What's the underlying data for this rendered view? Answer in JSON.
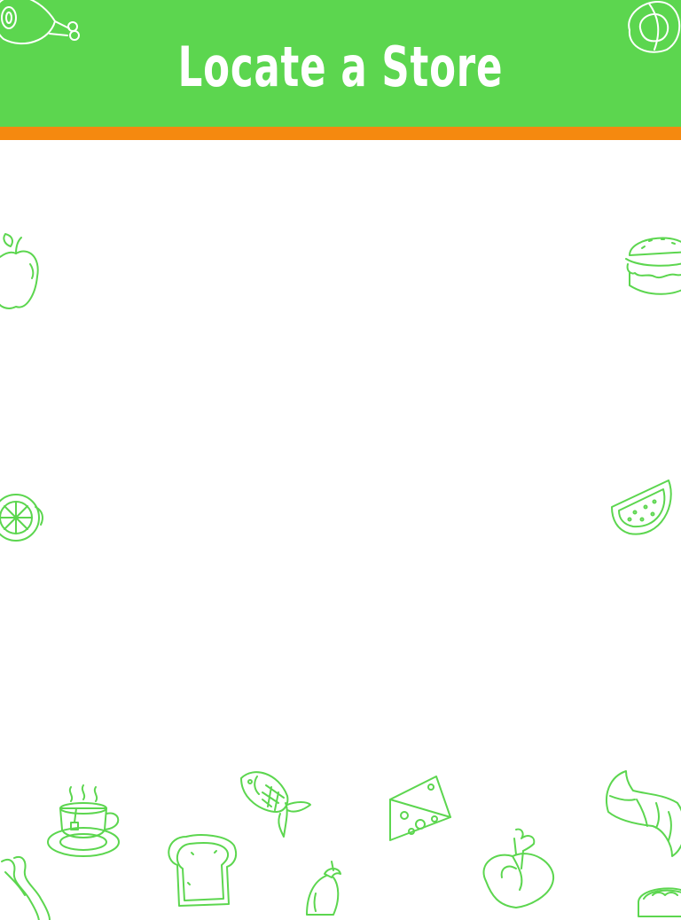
{
  "header": {
    "title": "Locate a Store"
  },
  "colors": {
    "header_background": "#5cd64f",
    "accent_stripe": "#f5890f",
    "doodle_stroke": "#5cd64f",
    "page_background": "#ffffff"
  },
  "decorations": [
    "ham-icon",
    "pretzel-icon",
    "apple-icon",
    "burger-icon",
    "lemon-icon",
    "watermelon-icon",
    "tea-cup-icon",
    "fish-icon",
    "cheese-icon",
    "croissant-icon",
    "bacon-icon",
    "bread-icon",
    "eggplant-icon",
    "chicken-leg-icon",
    "sushi-icon"
  ]
}
